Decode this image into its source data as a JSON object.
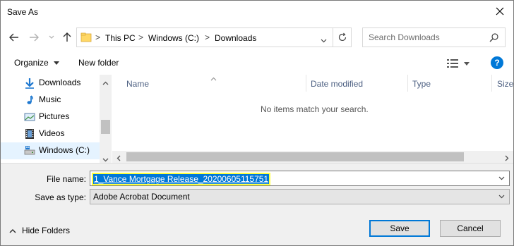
{
  "window": {
    "title": "Save As"
  },
  "address": {
    "crumbs": [
      "This PC",
      "Windows (C:)",
      "Downloads"
    ],
    "separator": ">"
  },
  "search": {
    "placeholder": "Search Downloads"
  },
  "toolbar": {
    "organize": "Organize",
    "new_folder": "New folder",
    "help": "?"
  },
  "sidebar": {
    "items": [
      {
        "label": "Downloads",
        "icon": "download-arrow-icon",
        "selected": false
      },
      {
        "label": "Music",
        "icon": "music-note-icon",
        "selected": false
      },
      {
        "label": "Pictures",
        "icon": "pictures-icon",
        "selected": false
      },
      {
        "label": "Videos",
        "icon": "videos-icon",
        "selected": false
      },
      {
        "label": "Windows (C:)",
        "icon": "drive-icon",
        "selected": true
      }
    ]
  },
  "columns": [
    "Name",
    "Date modified",
    "Type",
    "Size"
  ],
  "empty_message": "No items match your search.",
  "form": {
    "file_name_label": "File name:",
    "file_name_value": "1_Vance Mortgage Release_20200605115751",
    "save_type_label": "Save as type:",
    "save_type_value": "Adobe Acrobat Document"
  },
  "footer": {
    "hide_folders": "Hide Folders",
    "save": "Save",
    "cancel": "Cancel"
  },
  "colors": {
    "accent": "#0078d7",
    "highlight": "#ffff40",
    "bottom_panel": "#f0f0f0"
  }
}
